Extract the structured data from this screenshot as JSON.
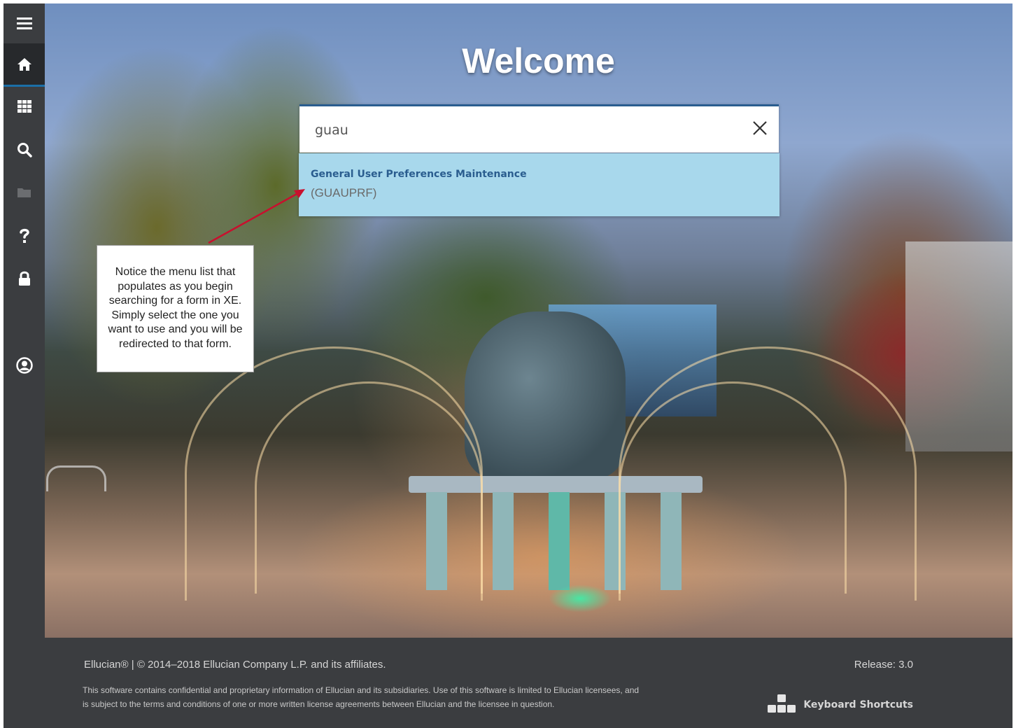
{
  "nav": {
    "items": [
      {
        "icon": "hamburger-menu-icon"
      },
      {
        "icon": "home-icon"
      },
      {
        "icon": "applications-grid-icon"
      },
      {
        "icon": "search-icon"
      },
      {
        "icon": "folder-icon"
      },
      {
        "icon": "help-icon"
      },
      {
        "icon": "lock-icon"
      },
      {
        "icon": "user-profile-icon"
      }
    ]
  },
  "page": {
    "title": "Welcome"
  },
  "search": {
    "value": "guau",
    "clear_icon": "close-icon",
    "results": [
      {
        "title": "General User Preferences Maintenance",
        "code": "(GUAUPRF)"
      }
    ]
  },
  "annotation": {
    "text": "Notice the menu list that populates as you begin searching for a form in XE. Simply select the one you want to use and you will be redirected to that form.",
    "arrow_color": "#c8102e"
  },
  "footer": {
    "copyright": "Ellucian® | © 2014–2018 Ellucian Company L.P. and its affiliates.",
    "release": "Release: 3.0",
    "notice": "This software contains confidential and proprietary information of Ellucian and its subsidiaries. Use of this software is limited to Ellucian licensees, and is subject to the terms and conditions of one or more written license agreements between Ellucian and the licensee in question.",
    "shortcuts_label": "Keyboard Shortcuts",
    "shortcuts_icon": "keyboard-icon"
  },
  "colors": {
    "rail": "#3b3d40",
    "accent": "#2a5d8f",
    "result_bg": "#a8d8ec"
  }
}
